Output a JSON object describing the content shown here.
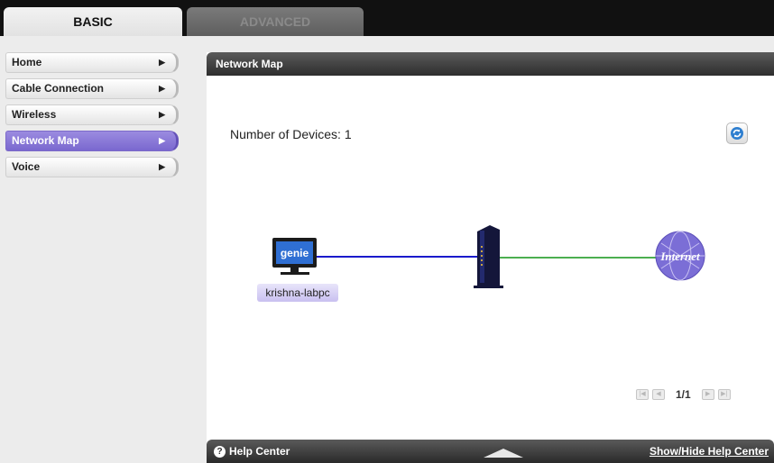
{
  "tabs": {
    "basic": "BASIC",
    "advanced": "ADVANCED"
  },
  "nav": {
    "items": [
      {
        "label": "Home",
        "arrow": "▶",
        "active": false
      },
      {
        "label": "Cable Connection",
        "arrow": "▶",
        "active": false
      },
      {
        "label": "Wireless",
        "arrow": "▶",
        "active": false
      },
      {
        "label": "Network Map",
        "arrow": "▶",
        "active": true
      },
      {
        "label": "Voice",
        "arrow": "▶",
        "active": false
      }
    ]
  },
  "panel": {
    "title": "Network Map",
    "device_count_label": "Number of Devices: 1",
    "refresh_icon": "refresh-icon",
    "device": {
      "screen_text": "genie",
      "name": "krishna-labpc"
    },
    "internet_label": "Internet",
    "pager": {
      "text": "1/1"
    }
  },
  "help": {
    "left_label": "Help Center",
    "right_label": "Show/Hide Help Center"
  },
  "colors": {
    "accent": "#7a68cf",
    "device_link": "#1a1acc",
    "internet_link": "#4caf50",
    "internet_globe": "#7b6ed6"
  }
}
